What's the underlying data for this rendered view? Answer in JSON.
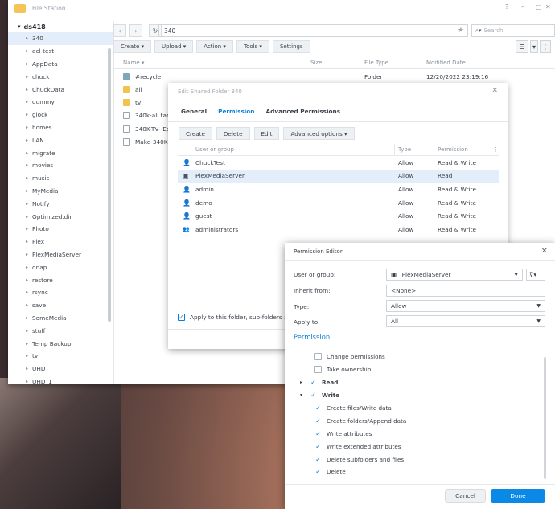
{
  "file_station": {
    "title": "File Station",
    "window_controls": [
      "?",
      "–",
      "▢",
      "✕"
    ],
    "tree_root": "ds418",
    "tree_items": [
      "340",
      "acl-test",
      "AppData",
      "chuck",
      "ChuckData",
      "dummy",
      "glock",
      "homes",
      "LAN",
      "migrate",
      "movies",
      "music",
      "MyMedia",
      "Notify",
      "Optimized.dir",
      "Photo",
      "Plex",
      "PlexMediaServer",
      "qnap",
      "restore",
      "rsync",
      "save",
      "SomeMedia",
      "stuff",
      "Temp Backup",
      "tv",
      "UHD",
      "UHD_1"
    ],
    "selected_item": "340",
    "path": "340",
    "search_placeholder": "Search",
    "toolbar": {
      "create": "Create ▾",
      "upload": "Upload ▾",
      "action": "Action ▾",
      "tools": "Tools ▾",
      "settings": "Settings"
    },
    "columns": {
      "name": "Name ▾",
      "size": "Size",
      "type": "File Type",
      "modified": "Modified Date"
    },
    "files": [
      {
        "name": "#recycle",
        "type": "Folder",
        "modified": "12/20/2022 23:19:16"
      },
      {
        "name": "all"
      },
      {
        "name": "tv"
      },
      {
        "name": "340k-all.tar"
      },
      {
        "name": "340K-TV--Ep"
      },
      {
        "name": "Make-340K"
      }
    ]
  },
  "edit_dialog": {
    "title": "Edit Shared Folder 340",
    "tabs": [
      "General",
      "Permission",
      "Advanced Permissions"
    ],
    "active_tab": "Permission",
    "buttons": {
      "create": "Create",
      "delete": "Delete",
      "edit": "Edit",
      "advanced": "Advanced options ▾"
    },
    "columns": {
      "user": "User or group",
      "type": "Type",
      "perm": "Permission"
    },
    "rows": [
      {
        "user": "ChuckTest",
        "type": "Allow",
        "perm": "Read & Write"
      },
      {
        "user": "PlexMediaServer",
        "type": "Allow",
        "perm": "Read"
      },
      {
        "user": "admin",
        "type": "Allow",
        "perm": "Read & Write"
      },
      {
        "user": "demo",
        "type": "Allow",
        "perm": "Read & Write"
      },
      {
        "user": "guest",
        "type": "Allow",
        "perm": "Read & Write"
      },
      {
        "user": "administrators",
        "type": "Allow",
        "perm": "Read & Write"
      }
    ],
    "apply_label": "Apply to this folder, sub-folders and"
  },
  "perm_editor": {
    "title": "Permission Editor",
    "labels": {
      "user": "User or group:",
      "inherit": "Inherit from:",
      "type": "Type:",
      "apply": "Apply to:"
    },
    "values": {
      "user": "PlexMediaServer",
      "inherit": "<None>",
      "type": "Allow",
      "apply": "All"
    },
    "section": "Permission",
    "items": [
      {
        "label": "Change permissions",
        "checked": false,
        "level": 1
      },
      {
        "label": "Take ownership",
        "checked": false,
        "level": 1
      },
      {
        "label": "Read",
        "checked": true,
        "level": 0,
        "expander": "▸"
      },
      {
        "label": "Write",
        "checked": true,
        "level": 0,
        "expander": "▾"
      },
      {
        "label": "Create files/Write data",
        "checked": true,
        "level": 1
      },
      {
        "label": "Create folders/Append data",
        "checked": true,
        "level": 1
      },
      {
        "label": "Write attributes",
        "checked": true,
        "level": 1
      },
      {
        "label": "Write extended attributes",
        "checked": true,
        "level": 1
      },
      {
        "label": "Delete subfolders and files",
        "checked": true,
        "level": 1
      },
      {
        "label": "Delete",
        "checked": true,
        "level": 1
      }
    ],
    "cancel": "Cancel",
    "done": "Done"
  }
}
